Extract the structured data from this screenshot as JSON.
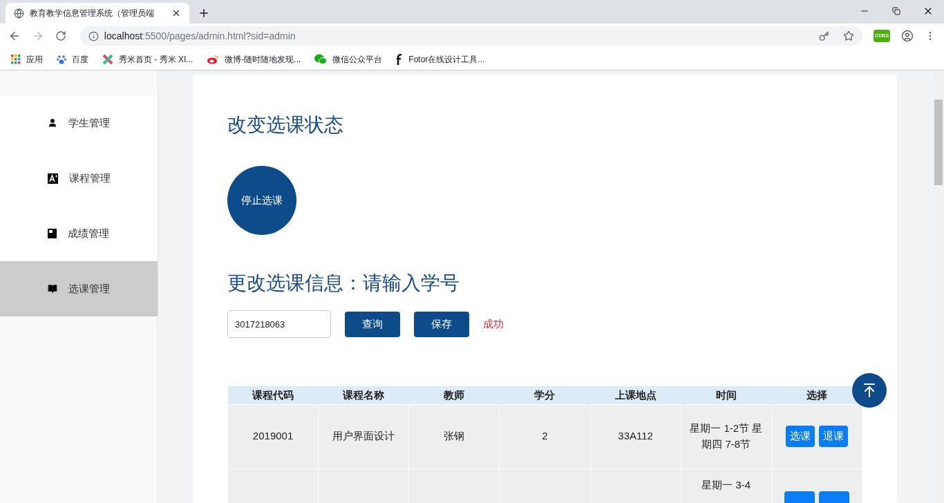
{
  "browser": {
    "tab_title": "教育教学信息管理系统（管理员端",
    "url_host": "localhost",
    "url_rest": ":5500/pages/admin.html?sid=admin",
    "extension_label": "CORS",
    "bookmarks": [
      {
        "label": "应用",
        "kind": "apps"
      },
      {
        "label": "百度",
        "kind": "paw"
      },
      {
        "label": "秀米首页 - 秀米 XI...",
        "kind": "xiumi"
      },
      {
        "label": "微博-随时随地发现...",
        "kind": "weibo"
      },
      {
        "label": "微信公众平台",
        "kind": "wechat"
      },
      {
        "label": "Fotor在线设计工具...",
        "kind": "fotor"
      }
    ]
  },
  "sidebar": {
    "items": [
      {
        "label": "学生管理",
        "kind": "person",
        "selected": false
      },
      {
        "label": "课程管理",
        "kind": "letter",
        "selected": false
      },
      {
        "label": "成绩管理",
        "kind": "book",
        "selected": false
      },
      {
        "label": "选课管理",
        "kind": "open-book",
        "selected": true
      }
    ]
  },
  "status_section": {
    "title": "改变选课状态",
    "toggle_label": "停止选课"
  },
  "edit_section": {
    "title": "更改选课信息：请输入学号",
    "student_id": "3017218063",
    "query_button": "查询",
    "save_button": "保存",
    "message": "成功"
  },
  "table": {
    "columns": [
      "课程代码",
      "课程名称",
      "教师",
      "学分",
      "上课地点",
      "时间",
      "选择"
    ],
    "rows": [
      {
        "kind": "full",
        "cells": [
          "2019001",
          "用户界面设计",
          "张钢",
          "2",
          "33A112",
          "星期一  1-2节 星期四  7-8节"
        ],
        "actions": [
          "选课",
          "退课"
        ]
      },
      {
        "kind": "partial",
        "time": "星期一  3-4"
      }
    ]
  }
}
